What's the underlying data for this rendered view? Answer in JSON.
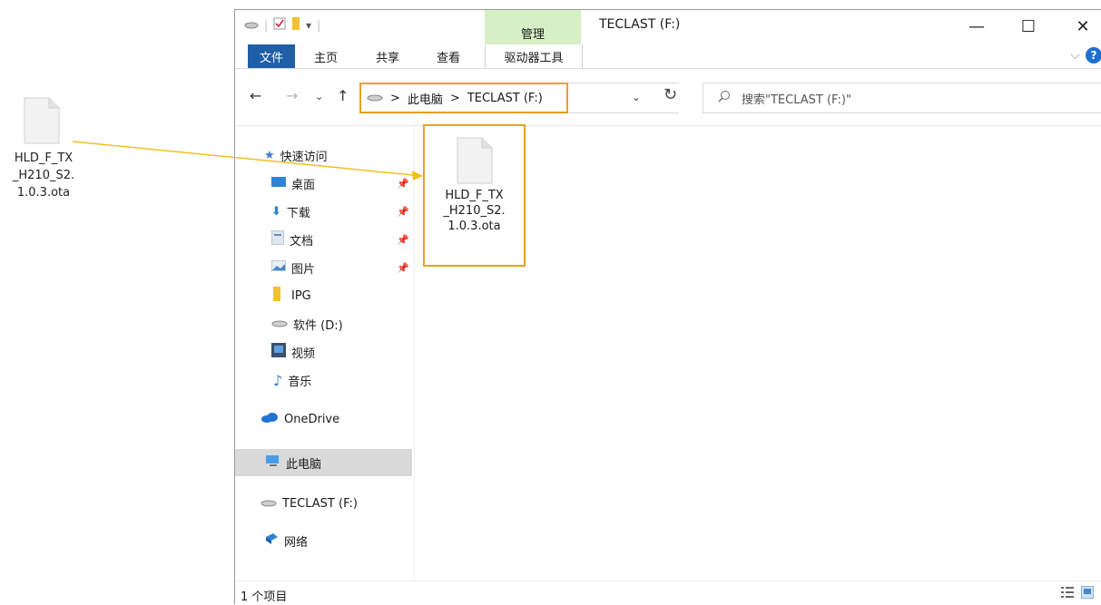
{
  "desktop_file": {
    "name": "HLD_F_TX\n_H210_S2.\n1.0.3.ota",
    "icon": "document-icon"
  },
  "window": {
    "title": "TECLAST (F:)",
    "context_tab": "管理",
    "controls": {
      "minimize": "—",
      "maximize": "☐",
      "close": "✕"
    }
  },
  "ribbon": {
    "tabs": [
      "文件",
      "主页",
      "共享",
      "查看",
      "驱动器工具"
    ],
    "expand_icon": "chevron-down-icon",
    "help": "?"
  },
  "address": {
    "path": [
      "此电脑",
      "TECLAST (F:)"
    ],
    "separator": ">",
    "search_placeholder": "搜索\"TECLAST (F:)\""
  },
  "sidebar": {
    "items": [
      {
        "label": "快速访问",
        "icon": "star-icon",
        "pinned": false
      },
      {
        "label": "桌面",
        "icon": "desktop-icon",
        "pinned": true
      },
      {
        "label": "下载",
        "icon": "download-icon",
        "pinned": true
      },
      {
        "label": "文档",
        "icon": "document-folder-icon",
        "pinned": true
      },
      {
        "label": "图片",
        "icon": "picture-icon",
        "pinned": true
      },
      {
        "label": "IPG",
        "icon": "folder-icon",
        "pinned": false
      },
      {
        "label": "软件 (D:)",
        "icon": "drive-icon",
        "pinned": false
      },
      {
        "label": "视频",
        "icon": "video-icon",
        "pinned": false
      },
      {
        "label": "音乐",
        "icon": "music-icon",
        "pinned": false
      },
      {
        "label": "OneDrive",
        "icon": "cloud-icon",
        "pinned": false
      },
      {
        "label": "此电脑",
        "icon": "computer-icon",
        "pinned": false,
        "selected": true
      },
      {
        "label": "TECLAST (F:)",
        "icon": "drive-icon",
        "pinned": false
      },
      {
        "label": "网络",
        "icon": "network-icon",
        "pinned": false
      }
    ]
  },
  "content": {
    "files": [
      {
        "name": "HLD_F_TX\n_H210_S2.\n1.0.3.ota",
        "icon": "document-icon"
      }
    ]
  },
  "status": {
    "item_count": "1 个项目"
  },
  "colors": {
    "highlight_box": "#e6a121",
    "manage_tab": "#d6efc4",
    "file_tab": "#1f5fa8",
    "arrow": "#f0c020"
  }
}
